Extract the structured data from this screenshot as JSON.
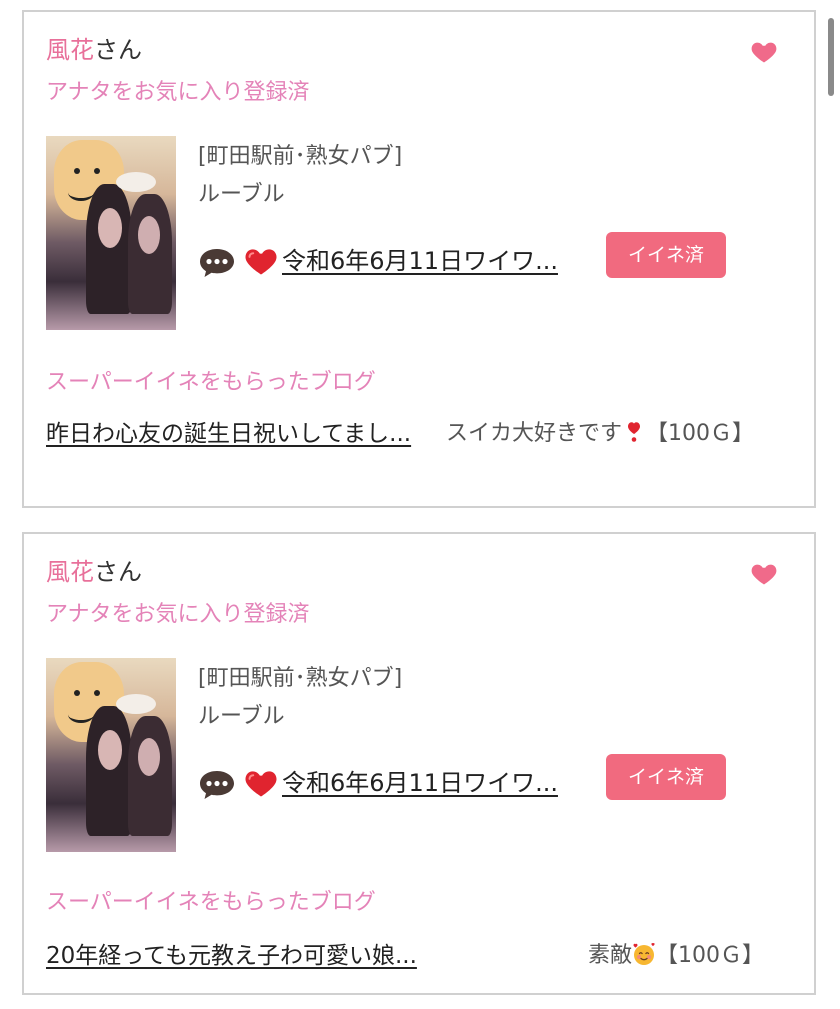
{
  "colors": {
    "pink_text": "#e483b8",
    "name_pink": "#e8709a",
    "like_button_bg": "#f16a7f",
    "heart": "#f06a8a",
    "border": "#d0d0d0"
  },
  "cards": [
    {
      "name": "風花",
      "name_suffix": "さん",
      "favorite_status": "アナタをお気に入り登録済",
      "shop_area": "[町田駅前･熟女パブ]",
      "shop_name": "ルーブル",
      "post_title": "令和6年6月11日ワイワ...",
      "like_button_label": "イイネ済",
      "section_title": "スーパーイイネをもらったブログ",
      "blog_title": "昨日わ心友の誕生日祝いしてまし...",
      "blog_comment_text": "スイカ大好きです",
      "blog_comment_reward": "【100Ｇ】",
      "blog_comment_emoji": "exclamation-heart-icon"
    },
    {
      "name": "風花",
      "name_suffix": "さん",
      "favorite_status": "アナタをお気に入り登録済",
      "shop_area": "[町田駅前･熟女パブ]",
      "shop_name": "ルーブル",
      "post_title": "令和6年6月11日ワイワ...",
      "like_button_label": "イイネ済",
      "section_title": "スーパーイイネをもらったブログ",
      "blog_title": "20年経っても元教え子わ可愛い娘...",
      "blog_comment_text": "素敵",
      "blog_comment_reward": "【100Ｇ】",
      "blog_comment_emoji": "smiling-face-with-hearts-icon"
    }
  ]
}
